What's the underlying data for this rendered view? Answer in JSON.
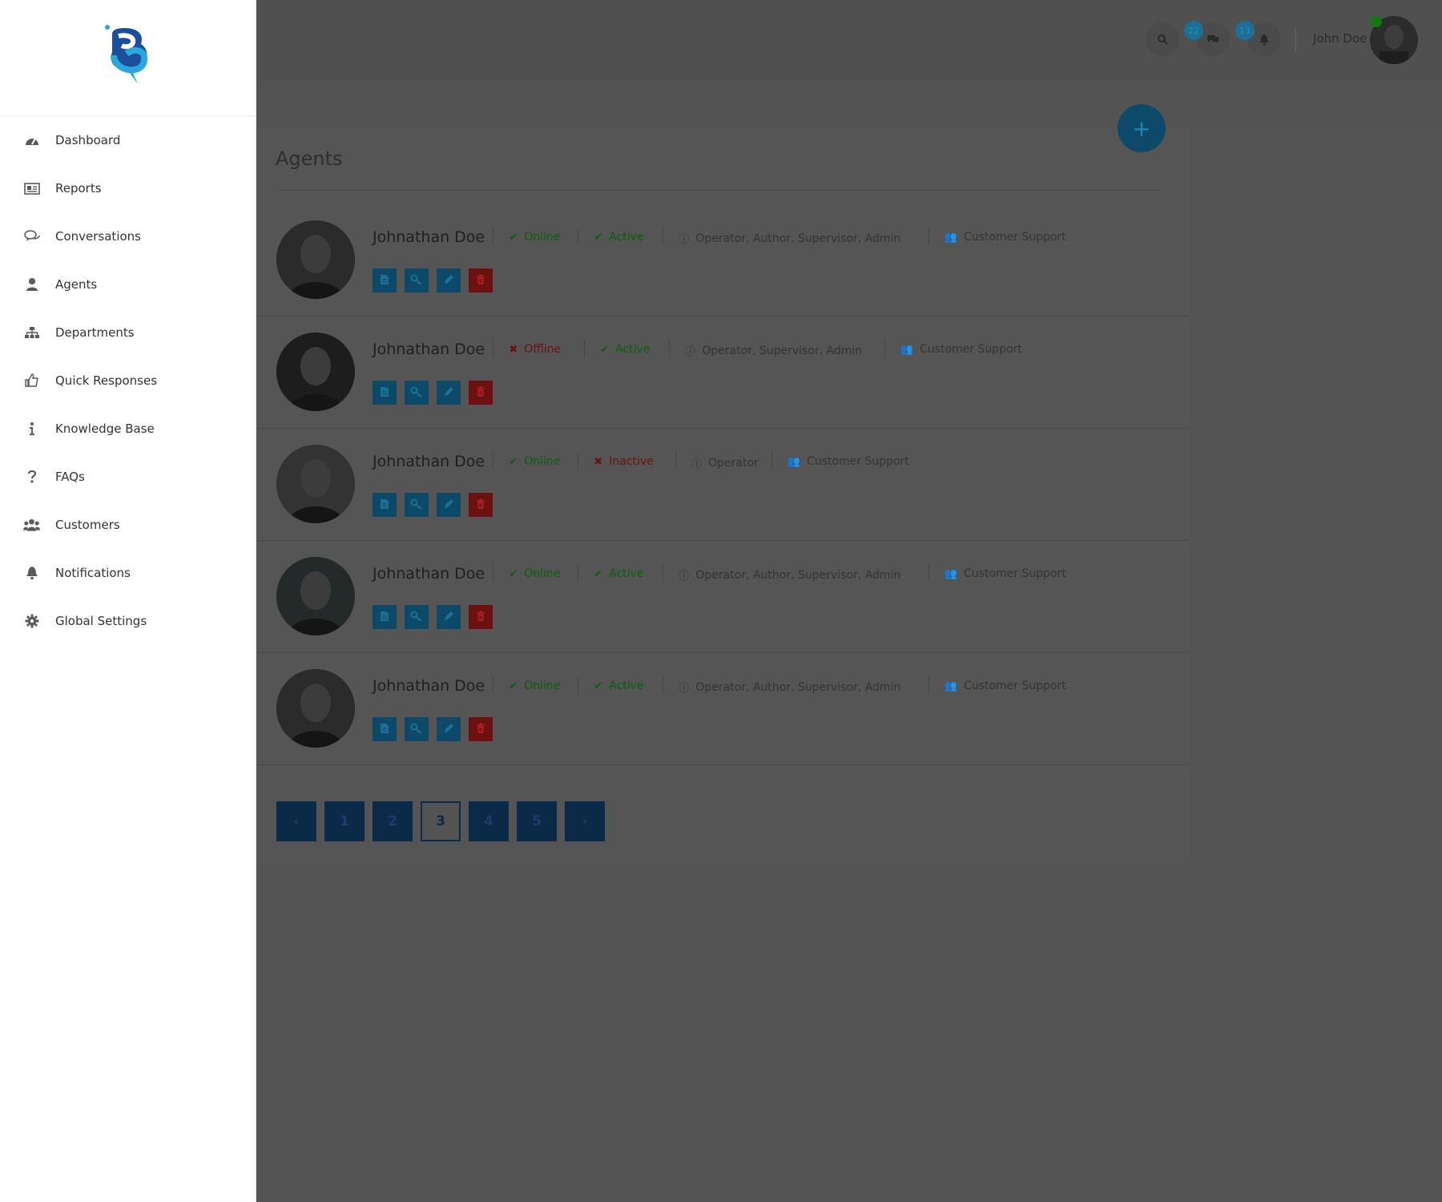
{
  "sidebar": {
    "items": [
      {
        "label": "Dashboard",
        "icon": "dashboard-icon"
      },
      {
        "label": "Reports",
        "icon": "reports-icon"
      },
      {
        "label": "Conversations",
        "icon": "conversations-icon"
      },
      {
        "label": "Agents",
        "icon": "agents-icon"
      },
      {
        "label": "Departments",
        "icon": "departments-icon"
      },
      {
        "label": "Quick Responses",
        "icon": "thumbs-up-icon"
      },
      {
        "label": "Knowledge Base",
        "icon": "info-icon"
      },
      {
        "label": "FAQs",
        "icon": "question-icon"
      },
      {
        "label": "Customers",
        "icon": "customers-icon"
      },
      {
        "label": "Notifications",
        "icon": "bell-icon"
      },
      {
        "label": "Global Settings",
        "icon": "gear-icon"
      }
    ]
  },
  "topbar": {
    "chat_badge": "22",
    "notification_badge": "13",
    "user_name": "John Doe"
  },
  "page": {
    "title": "Agents",
    "add_button": "+"
  },
  "agents": [
    {
      "name": "Johnathan Doe",
      "presence": "Online",
      "status": "Active",
      "roles": "Operator, Author, Supervisor, Admin",
      "department": "Customer Support"
    },
    {
      "name": "Johnathan Doe",
      "presence": "Offline",
      "status": "Active",
      "roles": "Operator, Supervisor, Admin",
      "department": "Customer Support"
    },
    {
      "name": "Johnathan Doe",
      "presence": "Online",
      "status": "Inactive",
      "roles": "Operator",
      "department": "Customer Support"
    },
    {
      "name": "Johnathan Doe",
      "presence": "Online",
      "status": "Active",
      "roles": "Operator, Author, Supervisor, Admin",
      "department": "Customer Support"
    },
    {
      "name": "Johnathan Doe",
      "presence": "Online",
      "status": "Active",
      "roles": "Operator, Author, Supervisor, Admin",
      "department": "Customer Support"
    }
  ],
  "pagination": {
    "prev": "‹",
    "pages": [
      "1",
      "2",
      "3",
      "4",
      "5"
    ],
    "current": "3",
    "next": "›"
  },
  "colors": {
    "brand_blue": "#1f86b7",
    "online_green": "#0b5f0b",
    "offline_red": "#6a1111",
    "pager_navy": "#0a2a47"
  }
}
